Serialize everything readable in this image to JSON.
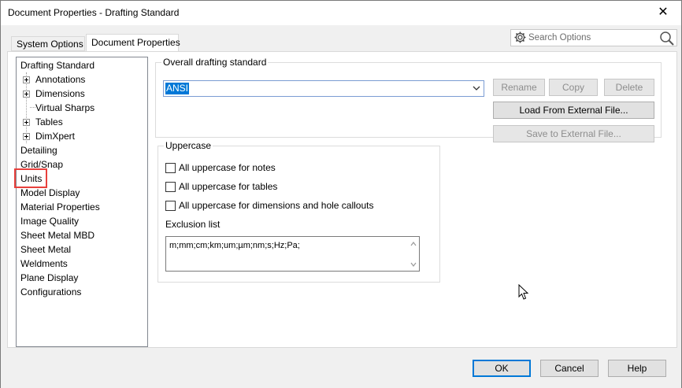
{
  "window": {
    "title": "Document Properties - Drafting Standard",
    "close_icon": "close-icon"
  },
  "tabs": [
    {
      "label": "System Options",
      "active": false
    },
    {
      "label": "Document Properties",
      "active": true
    }
  ],
  "search": {
    "placeholder": "Search Options",
    "gear_icon": "gear-icon",
    "search_icon": "magnifier-icon"
  },
  "tree": {
    "items": [
      {
        "label": "Drafting Standard",
        "level": 0,
        "expandable": false
      },
      {
        "label": "Annotations",
        "level": 1,
        "expandable": true
      },
      {
        "label": "Dimensions",
        "level": 1,
        "expandable": true
      },
      {
        "label": "Virtual Sharps",
        "level": 1,
        "expandable": false
      },
      {
        "label": "Tables",
        "level": 1,
        "expandable": true
      },
      {
        "label": "DimXpert",
        "level": 1,
        "expandable": true
      },
      {
        "label": "Detailing",
        "level": 0,
        "expandable": false
      },
      {
        "label": "Grid/Snap",
        "level": 0,
        "expandable": false
      },
      {
        "label": "Units",
        "level": 0,
        "expandable": false,
        "highlighted": true
      },
      {
        "label": "Model Display",
        "level": 0,
        "expandable": false
      },
      {
        "label": "Material Properties",
        "level": 0,
        "expandable": false
      },
      {
        "label": "Image Quality",
        "level": 0,
        "expandable": false
      },
      {
        "label": "Sheet Metal MBD",
        "level": 0,
        "expandable": false
      },
      {
        "label": "Sheet Metal",
        "level": 0,
        "expandable": false
      },
      {
        "label": "Weldments",
        "level": 0,
        "expandable": false
      },
      {
        "label": "Plane Display",
        "level": 0,
        "expandable": false
      },
      {
        "label": "Configurations",
        "level": 0,
        "expandable": false
      }
    ],
    "highlight_color": "#e8403c"
  },
  "drafting_standard": {
    "group_label": "Overall drafting standard",
    "selected_value": "ANSI",
    "rename_label": "Rename",
    "copy_label": "Copy",
    "delete_label": "Delete",
    "load_label": "Load From External File...",
    "save_label": "Save to External File..."
  },
  "uppercase": {
    "group_label": "Uppercase",
    "options": [
      {
        "label": "All uppercase for notes",
        "checked": false
      },
      {
        "label": "All uppercase for tables",
        "checked": false
      },
      {
        "label": "All uppercase for dimensions and hole callouts",
        "checked": false
      }
    ],
    "exclusion_label": "Exclusion list",
    "exclusion_value": "m;mm;cm;km;um;µm;nm;s;Hz;Pa;"
  },
  "footer": {
    "ok_label": "OK",
    "cancel_label": "Cancel",
    "help_label": "Help"
  },
  "colors": {
    "accent": "#0078d7",
    "highlight": "#e8403c"
  }
}
